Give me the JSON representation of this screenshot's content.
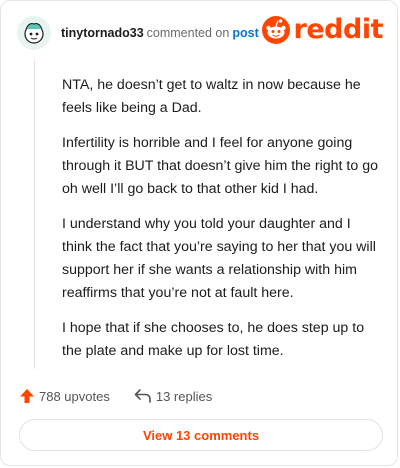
{
  "header": {
    "username": "tinytornado33",
    "commented_text": "commented on",
    "post_link": "post",
    "logo_text": "reddit"
  },
  "comment": {
    "paragraphs": [
      "NTA, he doesn’t get to waltz in now because he feels like being a Dad.",
      "Infertility is horrible and I feel for anyone going through it BUT that doesn’t give him the right to go oh well I’ll go back to that other kid I had.",
      "I understand why you told your daughter and I think the fact that you’re saying to her that you will support her if she wants a relationship with him reaffirms that you’re not at fault here.",
      "I hope that if she chooses to, he does step up to the plate and make up for lost time."
    ]
  },
  "actions": {
    "upvotes": "788 upvotes",
    "replies": "13 replies"
  },
  "view_button": "View 13 comments",
  "colors": {
    "brand": "#ff4500",
    "link": "#0079d3",
    "avatar_bg": "#e9f4f2"
  },
  "icons": [
    "avatar-icon",
    "reddit-snoo-icon",
    "upvote-arrow-icon",
    "reply-arrow-icon"
  ]
}
